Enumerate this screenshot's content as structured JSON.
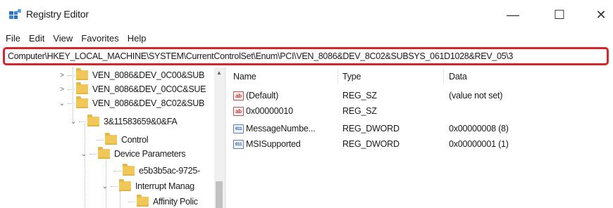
{
  "window": {
    "title": "Registry Editor",
    "icon": "registry-editor-icon",
    "controls": {
      "minimize": "—",
      "maximize": "☐",
      "close": "✕"
    }
  },
  "menu": {
    "items": [
      "File",
      "Edit",
      "View",
      "Favorites",
      "Help"
    ]
  },
  "address": {
    "path": "Computer\\HKEY_LOCAL_MACHINE\\SYSTEM\\CurrentControlSet\\Enum\\PCI\\VEN_8086&DEV_8C02&SUBSYS_061D1028&REV_05\\3"
  },
  "tree": {
    "items": [
      {
        "label": "VEN_8086&DEV_0C00&SUB",
        "chevron": ">"
      },
      {
        "label": "VEN_8086&DEV_0C0C&SUE",
        "chevron": ">"
      },
      {
        "label": "VEN_8086&DEV_8C02&SUB",
        "chevron": "v"
      },
      {
        "label": "3&11583659&0&FA",
        "chevron": "v"
      },
      {
        "label": "Control",
        "chevron": ""
      },
      {
        "label": "Device Parameters",
        "chevron": "v"
      },
      {
        "label": "e5b3b5ac-9725-",
        "chevron": ""
      },
      {
        "label": "Interrupt Manag",
        "chevron": "v"
      },
      {
        "label": "Affinity Polic",
        "chevron": ""
      }
    ]
  },
  "values": {
    "headers": {
      "name": "Name",
      "type": "Type",
      "data": "Data"
    },
    "rows": [
      {
        "icon": "string-value-icon",
        "glyph": "ab",
        "name": "(Default)",
        "type": "REG_SZ",
        "data": "(value not set)"
      },
      {
        "icon": "string-value-icon",
        "glyph": "ab",
        "name": "0x00000010",
        "type": "REG_SZ",
        "data": ""
      },
      {
        "icon": "binary-value-icon",
        "glyph": "011",
        "name": "MessageNumbe...",
        "type": "REG_DWORD",
        "data": "0x00000008 (8)"
      },
      {
        "icon": "binary-value-icon",
        "glyph": "011",
        "name": "MSISupported",
        "type": "REG_DWORD",
        "data": "0x00000001 (1)"
      }
    ]
  },
  "colors": {
    "address_highlight": "#d7262b",
    "folder": "#f1c75a"
  }
}
